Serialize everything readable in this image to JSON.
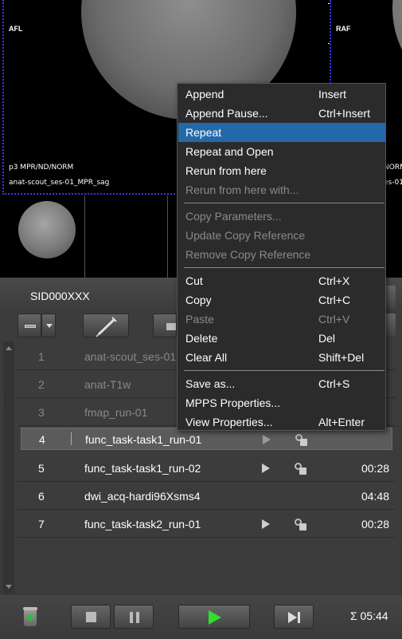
{
  "viewer": {
    "main_orientation_label": "AFL",
    "right_orientation_label": "RAF",
    "main_series_type": "p3 MPR/ND/NORM",
    "main_series_name": "anat-scout_ses-01_MPR_sag",
    "right_series_type_partial": "NORM",
    "right_series_name_partial": "es-01"
  },
  "panel": {
    "patient_id": "SID000XXX",
    "rows": [
      {
        "num": "1",
        "name": "anat-scout_ses-01",
        "time": "",
        "state": "done"
      },
      {
        "num": "2",
        "name": "anat-T1w",
        "time": "",
        "state": "done"
      },
      {
        "num": "3",
        "name": "fmap_run-01",
        "time": "",
        "state": "done"
      },
      {
        "num": "4",
        "name": "func_task-task1_run-01",
        "time": "",
        "state": "current"
      },
      {
        "num": "5",
        "name": "func_task-task1_run-02",
        "time": "00:28",
        "state": "queued"
      },
      {
        "num": "6",
        "name": "dwi_acq-hardi96Xsms4",
        "time": "04:48",
        "state": "queued"
      },
      {
        "num": "7",
        "name": "func_task-task2_run-01",
        "time": "00:28",
        "state": "queued"
      }
    ],
    "total_time": "Σ 05:44"
  },
  "context_menu": {
    "items": [
      {
        "label": "Append",
        "shortcut": "Insert"
      },
      {
        "label": "Append Pause...",
        "shortcut": "Ctrl+Insert"
      },
      {
        "label": "Repeat",
        "shortcut": ""
      },
      {
        "label": "Repeat and Open",
        "shortcut": ""
      },
      {
        "label": "Rerun from here",
        "shortcut": ""
      },
      {
        "label": "Rerun from here with...",
        "shortcut": ""
      },
      {
        "label": "Copy Parameters...",
        "shortcut": ""
      },
      {
        "label": "Update Copy Reference",
        "shortcut": ""
      },
      {
        "label": "Remove Copy Reference",
        "shortcut": ""
      },
      {
        "label": "Cut",
        "shortcut": "Ctrl+X"
      },
      {
        "label": "Copy",
        "shortcut": "Ctrl+C"
      },
      {
        "label": "Paste",
        "shortcut": "Ctrl+V"
      },
      {
        "label": "Delete",
        "shortcut": "Del"
      },
      {
        "label": "Clear All",
        "shortcut": "Shift+Del"
      },
      {
        "label": "Save as...",
        "shortcut": "Ctrl+S"
      },
      {
        "label": "MPPS Properties...",
        "shortcut": ""
      },
      {
        "label": "View Properties...",
        "shortcut": "Alt+Enter"
      }
    ],
    "highlighted_item": "Repeat",
    "disabled_items": [
      "Rerun from here with...",
      "Copy Parameters...",
      "Update Copy Reference",
      "Remove Copy Reference",
      "Paste"
    ]
  },
  "colors": {
    "menu_highlight": "#2469a7",
    "viewport_border": "#3535ff",
    "play_green": "#2ee02e"
  }
}
